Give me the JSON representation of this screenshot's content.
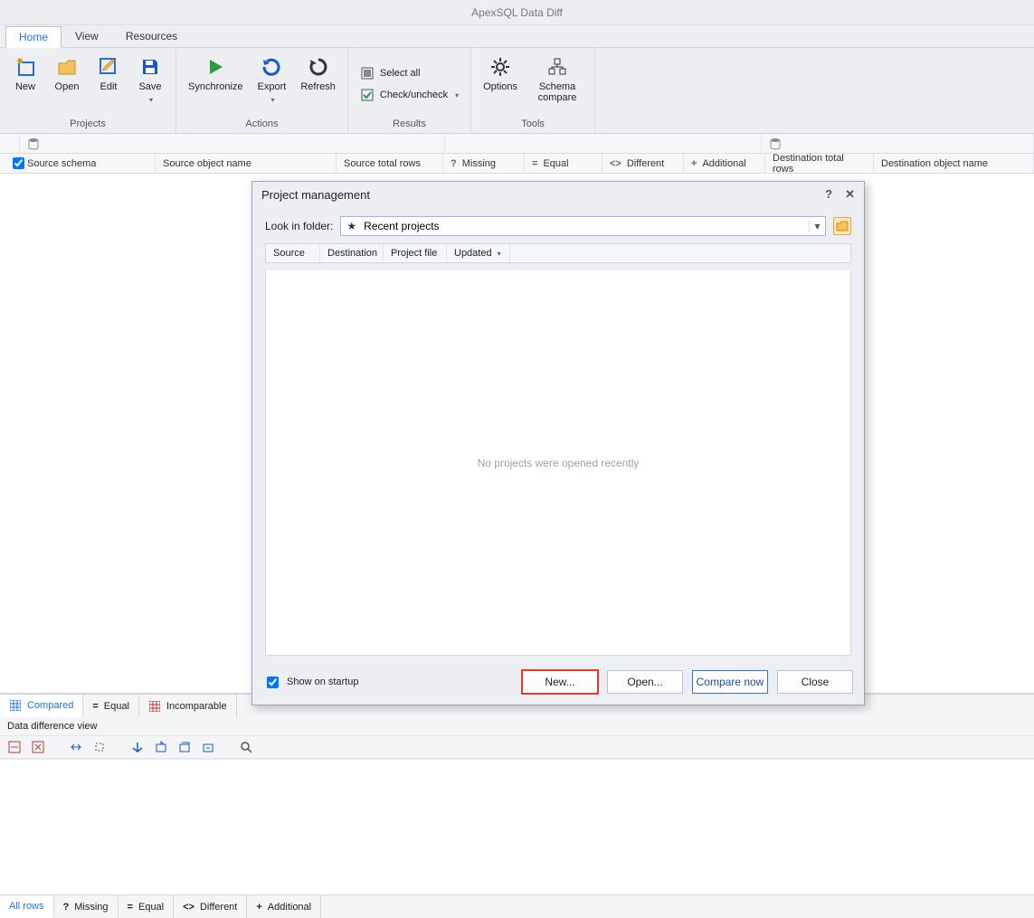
{
  "app": {
    "title": "ApexSQL Data Diff"
  },
  "tabs": {
    "home": "Home",
    "view": "View",
    "resources": "Resources"
  },
  "ribbon": {
    "projects": {
      "label": "Projects",
      "new": "New",
      "open": "Open",
      "edit": "Edit",
      "save": "Save"
    },
    "actions": {
      "label": "Actions",
      "sync": "Synchronize",
      "export": "Export",
      "refresh": "Refresh"
    },
    "results": {
      "label": "Results",
      "select_all": "Select all",
      "check_uncheck": "Check/uncheck"
    },
    "tools": {
      "label": "Tools",
      "options": "Options",
      "schema": "Schema compare"
    }
  },
  "grid_headers": {
    "src_schema": "Source schema",
    "src_obj": "Source object name",
    "src_rows": "Source total rows",
    "missing": "Missing",
    "equal": "Equal",
    "different": "Different",
    "additional": "Additional",
    "dst_rows": "Destination total rows",
    "dst_obj": "Destination object name"
  },
  "lower_tabs": {
    "compared": "Compared",
    "equal": "Equal",
    "incomparable": "Incomparable"
  },
  "ddv": {
    "title": "Data difference view"
  },
  "status_tabs": {
    "all": "All rows",
    "missing": "Missing",
    "equal": "Equal",
    "different": "Different",
    "additional": "Additional"
  },
  "dialog": {
    "title": "Project management",
    "look_in_label": "Look in folder:",
    "look_in_value": "Recent projects",
    "cols": {
      "source": "Source",
      "dest": "Destination",
      "pfile": "Project file",
      "updated": "Updated"
    },
    "empty": "No projects were opened recently",
    "show_startup": "Show on startup",
    "buttons": {
      "new": "New...",
      "open": "Open...",
      "compare": "Compare now",
      "close": "Close"
    }
  }
}
